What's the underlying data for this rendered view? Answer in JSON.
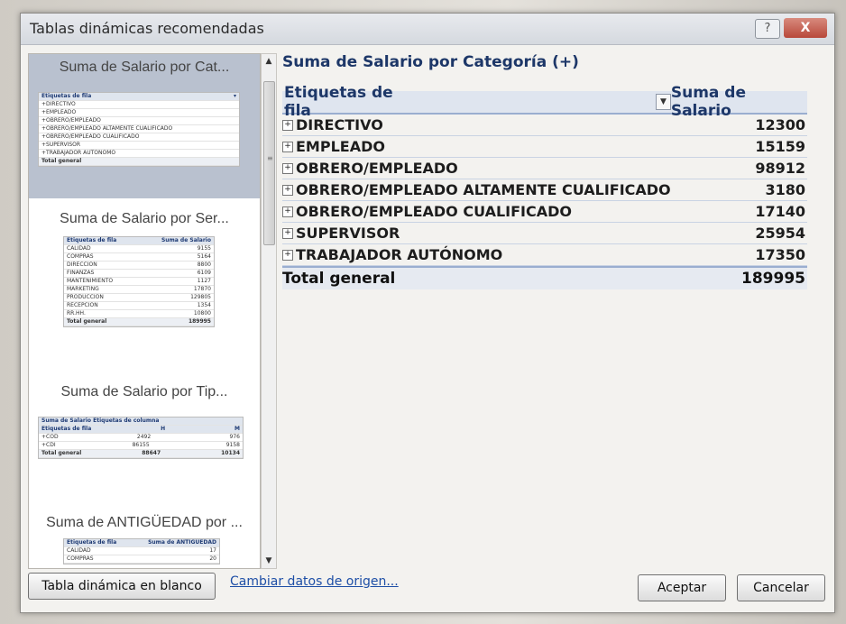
{
  "dialog": {
    "title": "Tablas dinámicas recomendadas",
    "help_label": "?",
    "close_label": "X"
  },
  "thumbnails": [
    {
      "title": "Suma de Salario por Cat...",
      "header_row": [
        "Etiquetas de fila",
        ""
      ],
      "rows": [
        [
          "+DIRECTIVO",
          ""
        ],
        [
          "+EMPLEADO",
          ""
        ],
        [
          "+OBRERO/EMPLEADO",
          ""
        ],
        [
          "+OBRERO/EMPLEADO ALTAMENTE CUALIFICADO",
          ""
        ],
        [
          "+OBRERO/EMPLEADO CUALIFICADO",
          ""
        ],
        [
          "+SUPERVISOR",
          ""
        ],
        [
          "+TRABAJADOR AUTÓNOMO",
          ""
        ]
      ],
      "total": [
        "Total general",
        ""
      ]
    },
    {
      "title": "Suma de Salario por Ser...",
      "header_row": [
        "Etiquetas de fila",
        "Suma de Salario"
      ],
      "rows": [
        [
          "CALIDAD",
          "9155"
        ],
        [
          "COMPRAS",
          "5164"
        ],
        [
          "DIRECCIÓN",
          "8800"
        ],
        [
          "FINANZAS",
          "6109"
        ],
        [
          "MANTENIMIENTO",
          "1127"
        ],
        [
          "MARKETING",
          "17870"
        ],
        [
          "PRODUCCIÓN",
          "129805"
        ],
        [
          "RECEPCIÓN",
          "1354"
        ],
        [
          "RR.HH.",
          "10800"
        ]
      ],
      "total": [
        "Total general",
        "189995"
      ]
    },
    {
      "title": "Suma de Salario por Tip...",
      "header_row": [
        "Suma de Salario   Etiquetas de columna",
        ""
      ],
      "sub_header": [
        "Etiquetas de fila",
        "H",
        "M"
      ],
      "rows": [
        [
          "+COD",
          "2492",
          "976"
        ],
        [
          "+CDI",
          "86155",
          "9158"
        ]
      ],
      "total": [
        "Total general",
        "88647",
        "10134"
      ]
    },
    {
      "title": "Suma de ANTIGÜEDAD por ...",
      "header_row": [
        "Etiquetas de fila",
        "Suma de ANTIGÜEDAD"
      ],
      "rows": [
        [
          "CALIDAD",
          "17"
        ],
        [
          "COMPRAS",
          "20"
        ]
      ]
    }
  ],
  "preview": {
    "title": "Suma de Salario por Categoría (+)",
    "header_label": "Etiquetas de fila",
    "header_value": "Suma de Salario",
    "rows": [
      {
        "label": "DIRECTIVO",
        "value": "12300"
      },
      {
        "label": "EMPLEADO",
        "value": "15159"
      },
      {
        "label": "OBRERO/EMPLEADO",
        "value": "98912"
      },
      {
        "label": "OBRERO/EMPLEADO ALTAMENTE CUALIFICADO",
        "value": "3180"
      },
      {
        "label": "OBRERO/EMPLEADO CUALIFICADO",
        "value": "17140"
      },
      {
        "label": "SUPERVISOR",
        "value": "25954"
      },
      {
        "label": "TRABAJADOR AUTÓNOMO",
        "value": "17350"
      }
    ],
    "total_label": "Total general",
    "total_value": "189995"
  },
  "footer": {
    "blank_pivot_label": "Tabla dinámica en blanco",
    "change_source_label": "Cambiar datos de origen...",
    "accept_label": "Aceptar",
    "cancel_label": "Cancelar"
  }
}
